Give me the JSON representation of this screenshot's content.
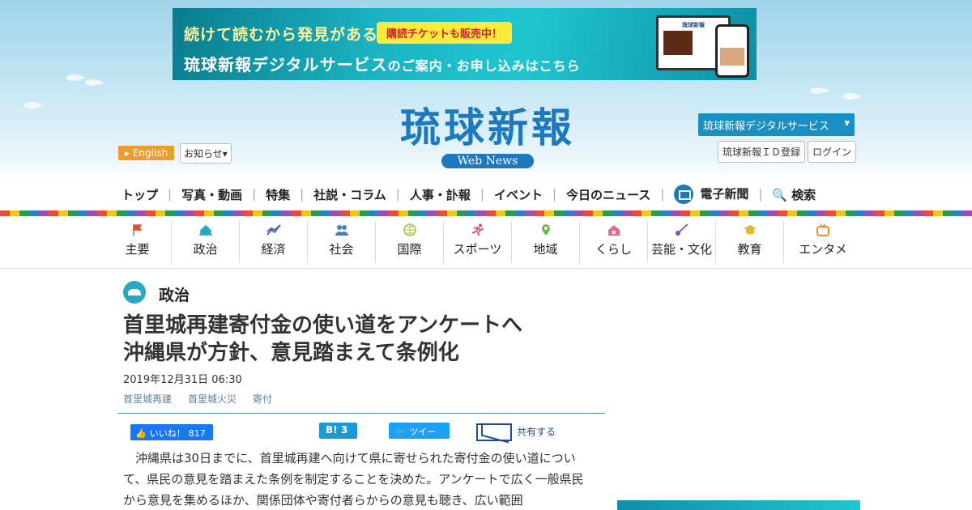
{
  "banner": {
    "line1": "続けて読むから発見がある",
    "ticket": "購読チケットも販売中！",
    "line2_main": "琉球新報デジタルサービス",
    "line2_small": "のご案内・お申し込みはこちら",
    "device_header": "琉球新報"
  },
  "header": {
    "logo_title": "琉球新報",
    "logo_sub": "Web News",
    "english": "English",
    "notice": "お知らせ",
    "digital_service": "琉球新報デジタルサービス",
    "id_register": "琉球新報ＩＤ登録",
    "login": "ログイン"
  },
  "mainnav": [
    "トップ",
    "写真・動画",
    "特集",
    "社説・コラム",
    "人事・訃報",
    "イベント",
    "今日のニュース",
    "電子新聞",
    "検索"
  ],
  "catnav": [
    {
      "label": "主要",
      "icon": "flag-icon",
      "color": "#e24a3b"
    },
    {
      "label": "政治",
      "icon": "building-icon",
      "color": "#2aa7c5"
    },
    {
      "label": "経済",
      "icon": "chart-icon",
      "color": "#4a67b5"
    },
    {
      "label": "社会",
      "icon": "people-icon",
      "color": "#4a7cc4"
    },
    {
      "label": "国際",
      "icon": "globe-icon",
      "color": "#a3c43a"
    },
    {
      "label": "スポーツ",
      "icon": "runner-icon",
      "color": "#e24a5a"
    },
    {
      "label": "地域",
      "icon": "pin-icon",
      "color": "#6cb84a"
    },
    {
      "label": "くらし",
      "icon": "house-icon",
      "color": "#e56a8a"
    },
    {
      "label": "芸能・文化",
      "icon": "sanshin-icon",
      "color": "#8a4fb5"
    },
    {
      "label": "教育",
      "icon": "cap-icon",
      "color": "#e8b730"
    },
    {
      "label": "エンタメ",
      "icon": "tv-icon",
      "color": "#ee8a2b"
    }
  ],
  "article": {
    "section": "政治",
    "headline_line1": "首里城再建寄付金の使い道をアンケートへ",
    "headline_line2": "沖縄県が方針、意見踏まえて条例化",
    "date": "2019年12月31日 06:30",
    "tags": [
      "首里城再建",
      "首里城火災",
      "寄付"
    ],
    "body": "沖縄県は30日までに、首里城再建へ向けて県に寄せられた寄付金の使い道について、県民の意見を踏まえた条例を制定することを決めた。アンケートで広く一般県民から意見を集めるほか、関係団体や寄付者らからの意見も聴き、広い範囲"
  },
  "share": {
    "like": "いいね！",
    "like_count": "817",
    "hatena": "B!",
    "hatena_count": "3",
    "tweet": "ツイート",
    "mail": "共有する"
  }
}
